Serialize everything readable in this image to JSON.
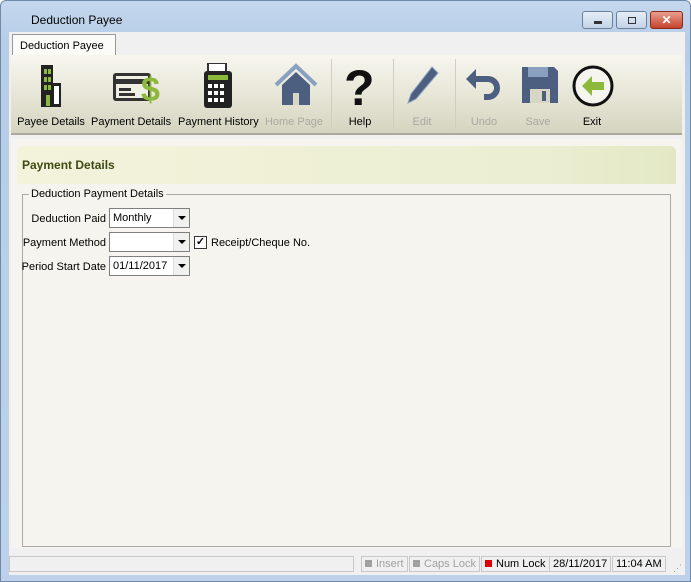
{
  "window": {
    "title": "Deduction Payee"
  },
  "tab": {
    "label": "Deduction Payee"
  },
  "toolbar": [
    {
      "label": "Payee Details",
      "icon": "building-icon",
      "enabled": true
    },
    {
      "label": "Payment Details",
      "icon": "card-dollar-icon",
      "enabled": true
    },
    {
      "label": "Payment History",
      "icon": "calculator-icon",
      "enabled": true
    },
    {
      "label": "Home Page",
      "icon": "home-icon",
      "enabled": false
    },
    {
      "label": "Help",
      "icon": "question-icon",
      "enabled": true
    },
    {
      "label": "Edit",
      "icon": "pencil-icon",
      "enabled": false
    },
    {
      "label": "Undo",
      "icon": "undo-icon",
      "enabled": false
    },
    {
      "label": "Save",
      "icon": "save-icon",
      "enabled": false
    },
    {
      "label": "Exit",
      "icon": "exit-icon",
      "enabled": true
    }
  ],
  "section": {
    "title": "Payment Details",
    "group_label": "Deduction Payment Details"
  },
  "form": {
    "deduction_paid": {
      "label": "Deduction Paid",
      "value": "Monthly"
    },
    "payment_method": {
      "label": "Payment Method",
      "value": ""
    },
    "receipt": {
      "label": "Receipt/Cheque No.",
      "checked": true
    },
    "period_start": {
      "label": "Period Start Date",
      "value": "01/11/2017"
    }
  },
  "status": {
    "insert": "Insert",
    "caps": "Caps Lock",
    "num": "Num Lock",
    "date": "28/11/2017",
    "time": "11:04 AM"
  },
  "colors": {
    "accent_green": "#8cb83c",
    "icon_blue": "#4c5f80",
    "num_on": "#e00000"
  }
}
